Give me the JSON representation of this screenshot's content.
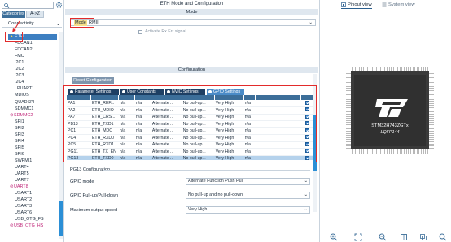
{
  "left_panel": {
    "tabs": [
      "Categories",
      "A->Z"
    ],
    "category": "Connectivity",
    "items": [
      {
        "label": "ETH",
        "state": "selected-warning"
      },
      {
        "label": "FDCAN1",
        "state": "normal"
      },
      {
        "label": "FDCAN2",
        "state": "normal"
      },
      {
        "label": "FMC",
        "state": "normal"
      },
      {
        "label": "I2C1",
        "state": "normal"
      },
      {
        "label": "I2C2",
        "state": "normal"
      },
      {
        "label": "I2C3",
        "state": "normal"
      },
      {
        "label": "I2C4",
        "state": "normal"
      },
      {
        "label": "LPUART1",
        "state": "normal"
      },
      {
        "label": "MDIOS",
        "state": "normal"
      },
      {
        "label": "QUADSPI",
        "state": "normal"
      },
      {
        "label": "SDMMC1",
        "state": "normal"
      },
      {
        "label": "SDMMC2",
        "state": "configured"
      },
      {
        "label": "SPI1",
        "state": "normal"
      },
      {
        "label": "SPI2",
        "state": "normal"
      },
      {
        "label": "SPI3",
        "state": "normal"
      },
      {
        "label": "SPI4",
        "state": "normal"
      },
      {
        "label": "SPI5",
        "state": "normal"
      },
      {
        "label": "SPI6",
        "state": "normal"
      },
      {
        "label": "SWPMI1",
        "state": "normal"
      },
      {
        "label": "UART4",
        "state": "normal"
      },
      {
        "label": "UART5",
        "state": "normal"
      },
      {
        "label": "UART7",
        "state": "normal"
      },
      {
        "label": "UART8",
        "state": "configured"
      },
      {
        "label": "USART1",
        "state": "normal"
      },
      {
        "label": "USART2",
        "state": "normal"
      },
      {
        "label": "USART3",
        "state": "normal"
      },
      {
        "label": "USART6",
        "state": "normal"
      },
      {
        "label": "USB_OTG_FS",
        "state": "normal"
      },
      {
        "label": "USB_OTG_HS",
        "state": "configured"
      }
    ]
  },
  "main": {
    "title": "ETH Mode and Configuration",
    "mode_section": "Mode",
    "mode_label": "Mode",
    "mode_value": "RMII",
    "activate_label": "Activate Rx Err signal",
    "config_section": "Configuration",
    "reset_button": "Reset Configuration",
    "param_tabs": [
      {
        "label": "Parameter Settings",
        "active": false
      },
      {
        "label": "User Constants",
        "active": false
      },
      {
        "label": "NVIC Settings",
        "active": false
      },
      {
        "label": "GPIO Settings",
        "active": true
      }
    ],
    "gpio_rows": [
      {
        "pin": "PA1",
        "signal": "ETH_REF...",
        "a": "n/a",
        "b": "n/a",
        "mode": "Alternate ...",
        "pull": "No pull-up...",
        "speed": "Very High",
        "user": "n/a",
        "selected": false
      },
      {
        "pin": "PA2",
        "signal": "ETH_MDIO",
        "a": "n/a",
        "b": "n/a",
        "mode": "Alternate ...",
        "pull": "No pull-up...",
        "speed": "Very High",
        "user": "n/a",
        "selected": false
      },
      {
        "pin": "PA7",
        "signal": "ETH_CRS...",
        "a": "n/a",
        "b": "n/a",
        "mode": "Alternate ...",
        "pull": "No pull-up...",
        "speed": "Very High",
        "user": "n/a",
        "selected": false
      },
      {
        "pin": "PB13",
        "signal": "ETH_TXD1",
        "a": "n/a",
        "b": "n/a",
        "mode": "Alternate ...",
        "pull": "No pull-up...",
        "speed": "Very High",
        "user": "n/a",
        "selected": false
      },
      {
        "pin": "PC1",
        "signal": "ETH_MDC",
        "a": "n/a",
        "b": "n/a",
        "mode": "Alternate ...",
        "pull": "No pull-up...",
        "speed": "Very High",
        "user": "n/a",
        "selected": false
      },
      {
        "pin": "PC4",
        "signal": "ETH_RXD0",
        "a": "n/a",
        "b": "n/a",
        "mode": "Alternate ...",
        "pull": "No pull-up...",
        "speed": "Very High",
        "user": "n/a",
        "selected": false
      },
      {
        "pin": "PC5",
        "signal": "ETH_RXD1",
        "a": "n/a",
        "b": "n/a",
        "mode": "Alternate ...",
        "pull": "No pull-up...",
        "speed": "Very High",
        "user": "n/a",
        "selected": false
      },
      {
        "pin": "PG11",
        "signal": "ETH_TX_EN",
        "a": "n/a",
        "b": "n/a",
        "mode": "Alternate ...",
        "pull": "No pull-up...",
        "speed": "Very High",
        "user": "n/a",
        "selected": false
      },
      {
        "pin": "PG13",
        "signal": "ETH_TXD0",
        "a": "n/a",
        "b": "n/a",
        "mode": "Alternate ...",
        "pull": "No pull-up...",
        "speed": "Very High",
        "user": "n/a",
        "selected": true
      }
    ],
    "pg13_title": "PG13 Configuration",
    "fields": [
      {
        "label": "GPIO mode",
        "value": "Alternate Function Push Pull"
      },
      {
        "label": "GPIO Pull-up/Pull-down",
        "value": "No pull-up and no pull-down"
      },
      {
        "label": "Maximum output speed",
        "value": "Very High"
      }
    ]
  },
  "right_panel": {
    "tabs": [
      "Pinout view",
      "System view"
    ],
    "chip_part": "STM32H743ZGTx",
    "chip_package": "LQFP144"
  },
  "colors": {
    "accent": "#3c6e99",
    "selection": "#3d7fc1",
    "highlight_box": "#e22b2b",
    "warning": "#c0287a"
  }
}
